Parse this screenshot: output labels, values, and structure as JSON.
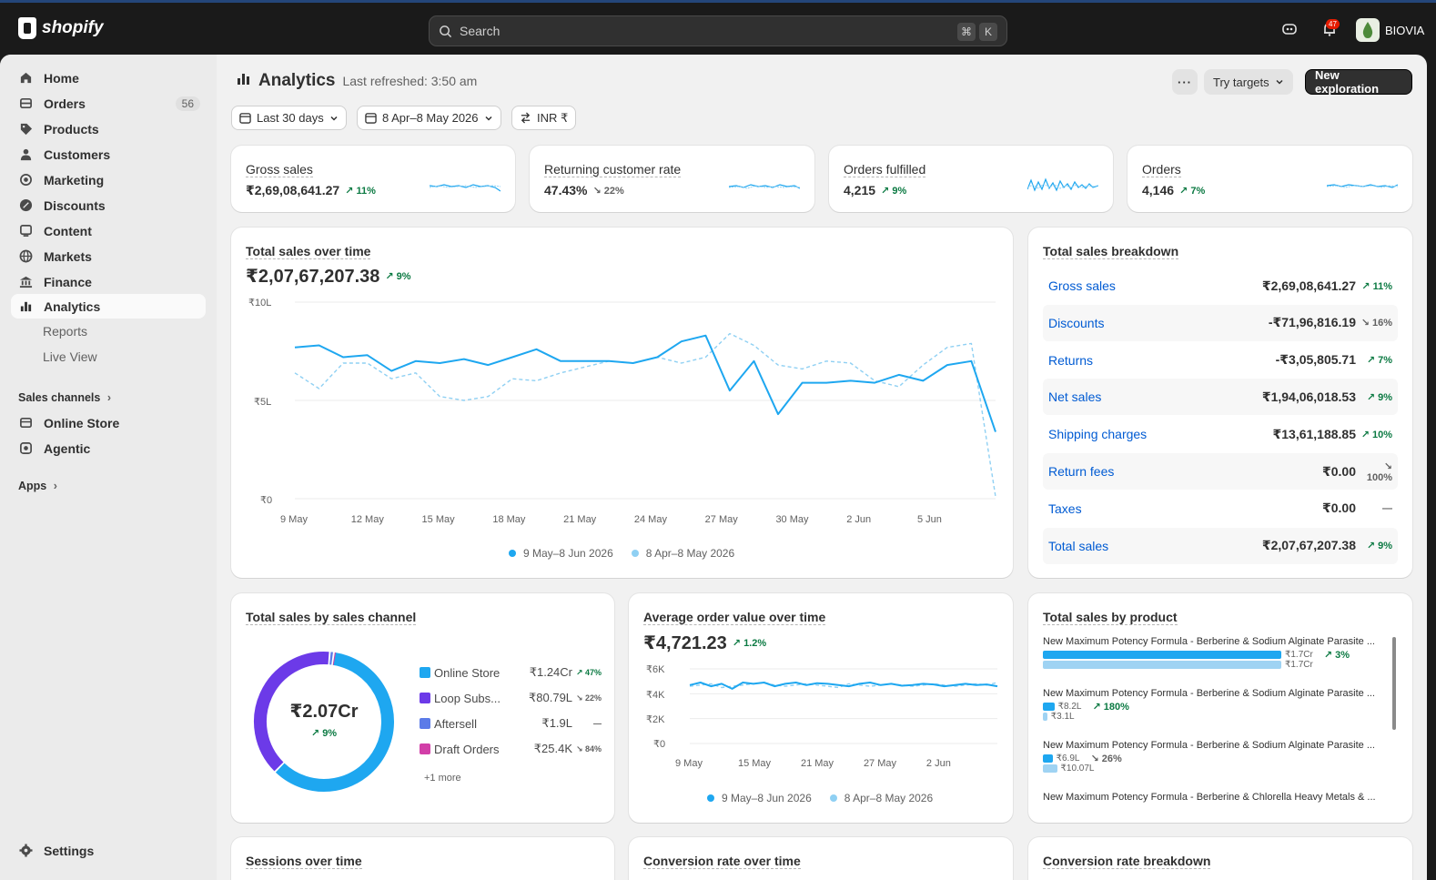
{
  "topbar": {
    "brand": "shopify",
    "search_placeholder": "Search",
    "kbd1": "⌘",
    "kbd2": "K",
    "notif_count": "47",
    "store_name": "BIOVIA"
  },
  "sidebar": {
    "items": [
      {
        "label": "Home",
        "icon": "home-icon"
      },
      {
        "label": "Orders",
        "icon": "orders-icon",
        "count": "56"
      },
      {
        "label": "Products",
        "icon": "tag-icon"
      },
      {
        "label": "Customers",
        "icon": "person-icon"
      },
      {
        "label": "Marketing",
        "icon": "target-icon"
      },
      {
        "label": "Discounts",
        "icon": "discount-icon"
      },
      {
        "label": "Content",
        "icon": "content-icon"
      },
      {
        "label": "Markets",
        "icon": "globe-icon"
      },
      {
        "label": "Finance",
        "icon": "bank-icon"
      },
      {
        "label": "Analytics",
        "icon": "chart-icon"
      }
    ],
    "sub_items": [
      "Reports",
      "Live View"
    ],
    "sales_channels_label": "Sales channels",
    "channels": [
      {
        "label": "Online Store",
        "icon": "store-icon"
      },
      {
        "label": "Agentic",
        "icon": "agentic-icon"
      }
    ],
    "apps_label": "Apps",
    "settings_label": "Settings"
  },
  "header": {
    "title": "Analytics",
    "refreshed": "Last refreshed: 3:50 am",
    "try_targets": "Try targets",
    "new_exploration": "New exploration",
    "filter_range": "Last 30 days",
    "filter_compare": "8 Apr–8 May 2026",
    "filter_currency": "INR ₹"
  },
  "kpis": [
    {
      "label": "Gross sales",
      "value": "₹2,69,08,641.27",
      "change": "11%",
      "dir": "up"
    },
    {
      "label": "Returning customer rate",
      "value": "47.43%",
      "change": "22%",
      "dir": "down"
    },
    {
      "label": "Orders fulfilled",
      "value": "4,215",
      "change": "9%",
      "dir": "up"
    },
    {
      "label": "Orders",
      "value": "4,146",
      "change": "7%",
      "dir": "up"
    }
  ],
  "total_sales": {
    "title": "Total sales over time",
    "value": "₹2,07,67,207.38",
    "change": "9%",
    "legend_current": "9 May–8 Jun 2026",
    "legend_previous": "8 Apr–8 May 2026"
  },
  "breakdown": {
    "title": "Total sales breakdown",
    "rows": [
      {
        "name": "Gross sales",
        "amount": "₹2,69,08,641.27",
        "change": "11%",
        "dir": "up"
      },
      {
        "name": "Discounts",
        "amount": "-₹71,96,816.19",
        "change": "16%",
        "dir": "down"
      },
      {
        "name": "Returns",
        "amount": "-₹3,05,805.71",
        "change": "7%",
        "dir": "up"
      },
      {
        "name": "Net sales",
        "amount": "₹1,94,06,018.53",
        "change": "9%",
        "dir": "up"
      },
      {
        "name": "Shipping charges",
        "amount": "₹13,61,188.85",
        "change": "10%",
        "dir": "up"
      },
      {
        "name": "Return fees",
        "amount": "₹0.00",
        "change": "100%",
        "dir": "down"
      },
      {
        "name": "Taxes",
        "amount": "₹0.00",
        "change": "—",
        "dir": "none"
      },
      {
        "name": "Total sales",
        "amount": "₹2,07,67,207.38",
        "change": "9%",
        "dir": "up"
      }
    ]
  },
  "channel": {
    "title": "Total sales by sales channel",
    "center_value": "₹2.07Cr",
    "center_change": "9%",
    "rows": [
      {
        "name": "Online Store",
        "value": "₹1.24Cr",
        "change": "47%",
        "dir": "up",
        "color": "#1ea7f0"
      },
      {
        "name": "Loop Subs...",
        "value": "₹80.79L",
        "change": "22%",
        "dir": "down",
        "color": "#6c3ae8"
      },
      {
        "name": "Aftersell",
        "value": "₹1.9L",
        "change": "—",
        "dir": "none",
        "color": "#5b7be8"
      },
      {
        "name": "Draft Orders",
        "value": "₹25.4K",
        "change": "84%",
        "dir": "down",
        "color": "#d23fa8"
      }
    ],
    "more": "+1 more"
  },
  "aov": {
    "title": "Average order value over time",
    "value": "₹4,721.23",
    "change": "1.2%",
    "legend_current": "9 May–8 Jun 2026",
    "legend_previous": "8 Apr–8 May 2026"
  },
  "products": {
    "title": "Total sales by product",
    "items": [
      {
        "name": "New Maximum Potency Formula - Berberine & Sodium Alginate Parasite ...",
        "cur": "₹1.7Cr",
        "prev": "₹1.7Cr",
        "change": "3%",
        "dir": "up"
      },
      {
        "name": "New Maximum Potency Formula - Berberine & Sodium Alginate Parasite ...",
        "cur": "₹8.2L",
        "prev": "₹3.1L",
        "change": "180%",
        "dir": "up"
      },
      {
        "name": "New Maximum Potency Formula - Berberine & Sodium Alginate Parasite ...",
        "cur": "₹6.9L",
        "prev": "₹10.07L",
        "change": "26%",
        "dir": "down"
      },
      {
        "name": "New Maximum Potency Formula - Berberine & Chlorella Heavy Metals & ...",
        "cur": "",
        "prev": "",
        "change": "",
        "dir": "none"
      }
    ]
  },
  "bottom_cards": [
    "Sessions over time",
    "Conversion rate over time",
    "Conversion rate breakdown"
  ],
  "chart_data": [
    {
      "type": "line",
      "title": "Total sales over time",
      "x": [
        "9 May",
        "12 May",
        "15 May",
        "18 May",
        "21 May",
        "24 May",
        "27 May",
        "30 May",
        "2 Jun",
        "5 Jun"
      ],
      "y_ticks": [
        "₹10L",
        "₹5L",
        "₹0"
      ],
      "ylim": [
        0,
        1000000
      ],
      "series": [
        {
          "name": "9 May–8 Jun 2026",
          "color": "#1ea7f0",
          "values": [
            770000,
            780000,
            720000,
            730000,
            650000,
            700000,
            690000,
            710000,
            680000,
            720000,
            760000,
            700000,
            700000,
            700000,
            690000,
            720000,
            800000,
            830000,
            550000,
            700000,
            430000,
            590000,
            590000,
            600000,
            590000,
            630000,
            600000,
            680000,
            700000,
            340000
          ]
        },
        {
          "name": "8 Apr–8 May 2026",
          "color": "#8fd0f3",
          "values": [
            640000,
            560000,
            690000,
            690000,
            610000,
            640000,
            520000,
            500000,
            520000,
            610000,
            600000,
            640000,
            670000,
            700000,
            690000,
            720000,
            690000,
            720000,
            840000,
            780000,
            680000,
            660000,
            700000,
            690000,
            600000,
            570000,
            680000,
            770000,
            790000,
            10000
          ]
        }
      ]
    },
    {
      "type": "pie",
      "title": "Total sales by sales channel",
      "categories": [
        "Online Store",
        "Loop Subs...",
        "Aftersell",
        "Draft Orders"
      ],
      "values": [
        12400000,
        8079000,
        190000,
        25400
      ]
    },
    {
      "type": "line",
      "title": "Average order value over time",
      "x": [
        "9 May",
        "15 May",
        "21 May",
        "27 May",
        "2 Jun"
      ],
      "y_ticks": [
        "₹6K",
        "₹4K",
        "₹2K",
        "₹0"
      ],
      "ylim": [
        0,
        6000
      ],
      "series": [
        {
          "name": "9 May–8 Jun 2026",
          "color": "#1ea7f0",
          "values": [
            4700,
            4900,
            4600,
            4800,
            4400,
            4900,
            4800,
            4900,
            4600,
            4800,
            4900,
            4700,
            4850,
            4800,
            4700,
            4600,
            4800,
            4900,
            4700,
            4800,
            4650,
            4700,
            4800,
            4750,
            4600,
            4700,
            4800,
            4700,
            4750,
            4600
          ]
        },
        {
          "name": "8 Apr–8 May 2026",
          "color": "#8fd0f3",
          "values": [
            4600,
            4700,
            4800,
            4500,
            4600,
            4700,
            4800,
            4900,
            4700,
            4600,
            4700,
            4800,
            4700,
            4600,
            4500,
            4800,
            4700,
            4600,
            4700,
            4800,
            4700,
            4600,
            4700,
            4800,
            4700,
            4600,
            4700,
            4800,
            4700,
            4900
          ]
        }
      ]
    },
    {
      "type": "bar",
      "title": "Total sales by product",
      "series": [
        {
          "name": "9 May–8 Jun 2026",
          "values": [
            17000000,
            820000,
            690000
          ]
        },
        {
          "name": "8 Apr–8 May 2026",
          "values": [
            17000000,
            310000,
            1007000
          ]
        }
      ]
    }
  ]
}
